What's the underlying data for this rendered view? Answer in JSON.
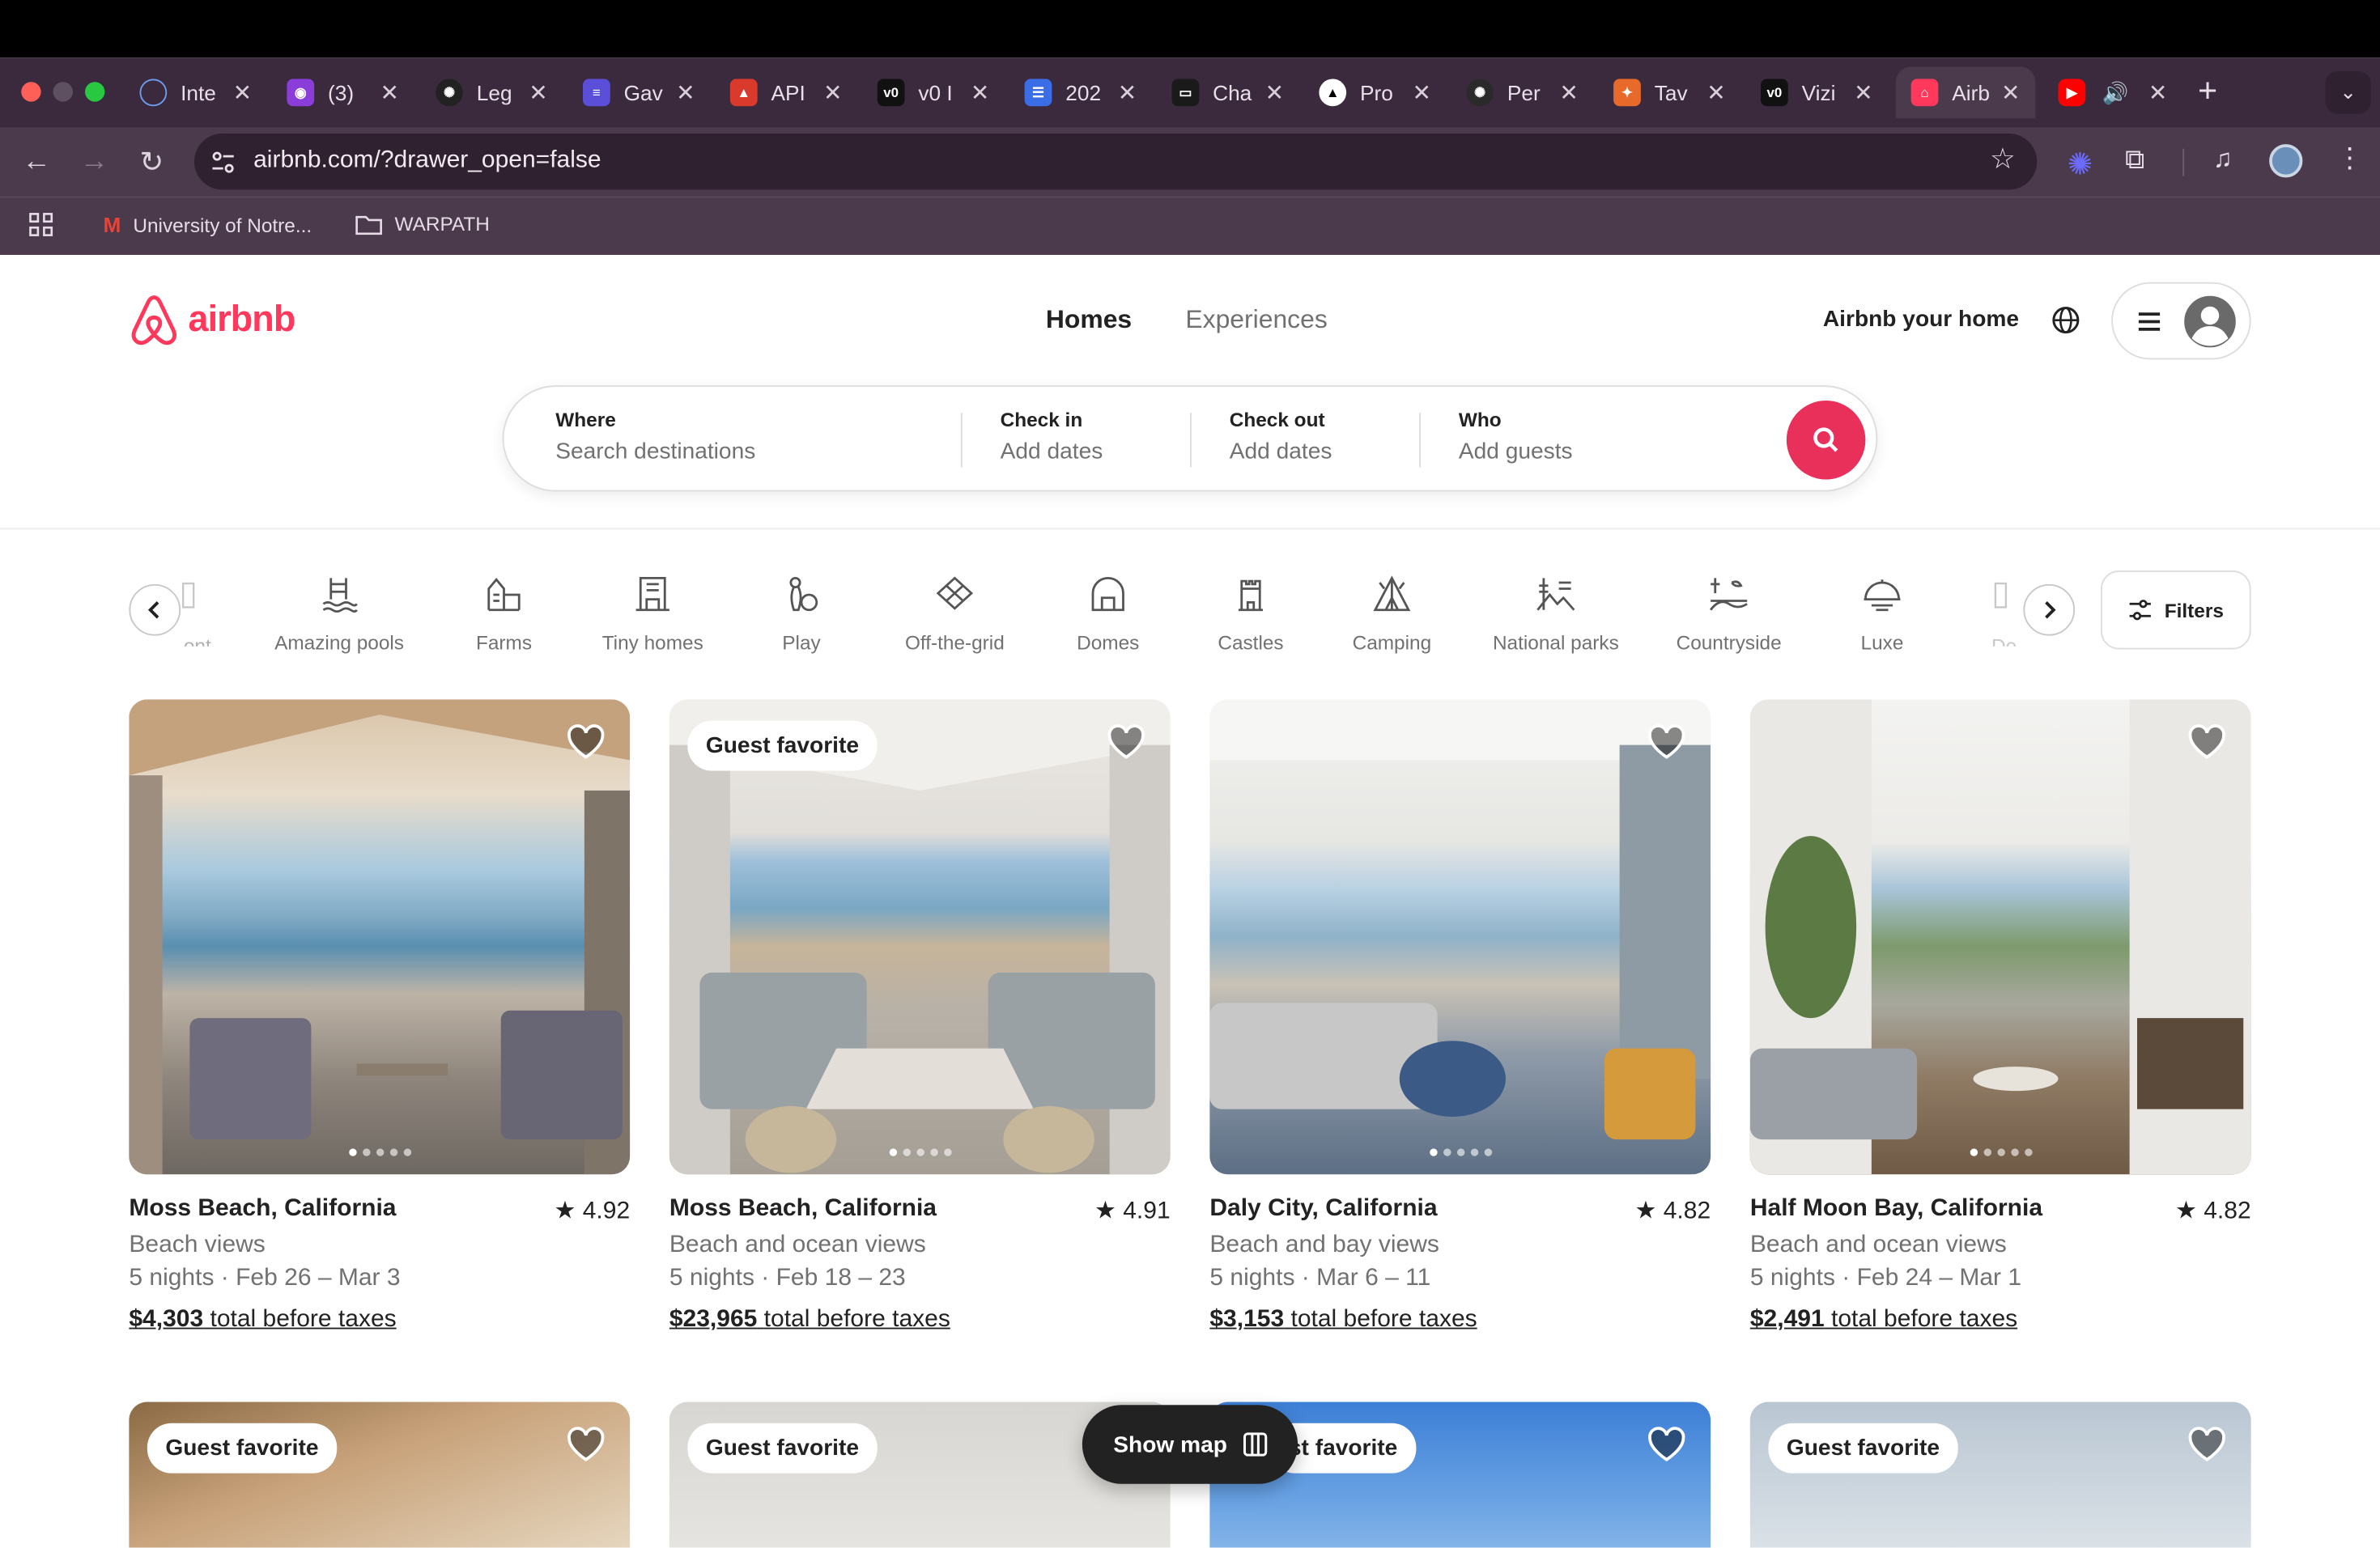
{
  "browser": {
    "tabs": [
      {
        "title": "Inte",
        "icon": "globe-icon",
        "color": "#3b6ecf"
      },
      {
        "title": "(3)",
        "icon": "chat-icon",
        "color": "#8b3dd9"
      },
      {
        "title": "Leg",
        "icon": "openai-icon",
        "color": "#222222"
      },
      {
        "title": "Gav",
        "icon": "stack-icon",
        "color": "#5b4fd9"
      },
      {
        "title": "API",
        "icon": "triangle-icon",
        "color": "#d93a2b"
      },
      {
        "title": "v0 I",
        "icon": "v0-icon",
        "color": "#111111"
      },
      {
        "title": "202",
        "icon": "docs-icon",
        "color": "#3b6ee6"
      },
      {
        "title": "Cha",
        "icon": "chat-bubble-icon",
        "color": "#1a1a1a"
      },
      {
        "title": "Pro",
        "icon": "vercel-icon",
        "color": "#000000"
      },
      {
        "title": "Per",
        "icon": "openai-icon",
        "color": "#2a2a2a"
      },
      {
        "title": "Tav",
        "icon": "tavily-icon",
        "color": "#e86a2a"
      },
      {
        "title": "Vizi",
        "icon": "v0-icon",
        "color": "#111111"
      },
      {
        "title": "Airb",
        "icon": "airbnb-icon",
        "color": "#ff385c"
      },
      {
        "title": "",
        "icon": "youtube-icon",
        "color": "#ff0000"
      }
    ],
    "url": "airbnb.com/?drawer_open=false",
    "bookmarks": [
      {
        "label": "University of Notre...",
        "icon": "gmail-icon"
      },
      {
        "label": "WARPATH",
        "icon": "folder-icon"
      }
    ]
  },
  "header": {
    "logo_text": "airbnb",
    "nav": [
      "Homes",
      "Experiences"
    ],
    "host_link": "Airbnb your home"
  },
  "search": {
    "where_label": "Where",
    "where_placeholder": "Search destinations",
    "checkin_label": "Check in",
    "checkin_value": "Add dates",
    "checkout_label": "Check out",
    "checkout_value": "Add dates",
    "who_label": "Who",
    "who_value": "Add guests"
  },
  "categories": {
    "partial_left": "ont",
    "items": [
      "Amazing pools",
      "Farms",
      "Tiny homes",
      "Play",
      "Off-the-grid",
      "Domes",
      "Castles",
      "Camping",
      "National parks",
      "Countryside",
      "Luxe"
    ],
    "partial_right": "De",
    "filters_label": "Filters"
  },
  "listings": [
    {
      "location": "Moss Beach, California",
      "rating": "4.92",
      "view": "Beach views",
      "dates": "5 nights · Feb 26 – Mar 3",
      "price": "$4,303",
      "price_suffix": "total before taxes",
      "badge": ""
    },
    {
      "location": "Moss Beach, California",
      "rating": "4.91",
      "view": "Beach and ocean views",
      "dates": "5 nights · Feb 18 – 23",
      "price": "$23,965",
      "price_suffix": "total before taxes",
      "badge": "Guest favorite"
    },
    {
      "location": "Daly City, California",
      "rating": "4.82",
      "view": "Beach and bay views",
      "dates": "5 nights · Mar 6 – 11",
      "price": "$3,153",
      "price_suffix": "total before taxes",
      "badge": ""
    },
    {
      "location": "Half Moon Bay, California",
      "rating": "4.82",
      "view": "Beach and ocean views",
      "dates": "5 nights · Feb 24 – Mar 1",
      "price": "$2,491",
      "price_suffix": "total before taxes",
      "badge": ""
    }
  ],
  "second_row_badges": [
    "Guest favorite",
    "Guest favorite",
    "st favorite",
    "Guest favorite"
  ],
  "show_map_label": "Show map",
  "colors": {
    "brand": "#ff385c",
    "chrome_tab_bar": "#3b2a3d",
    "chrome_toolbar": "#4b394c"
  }
}
